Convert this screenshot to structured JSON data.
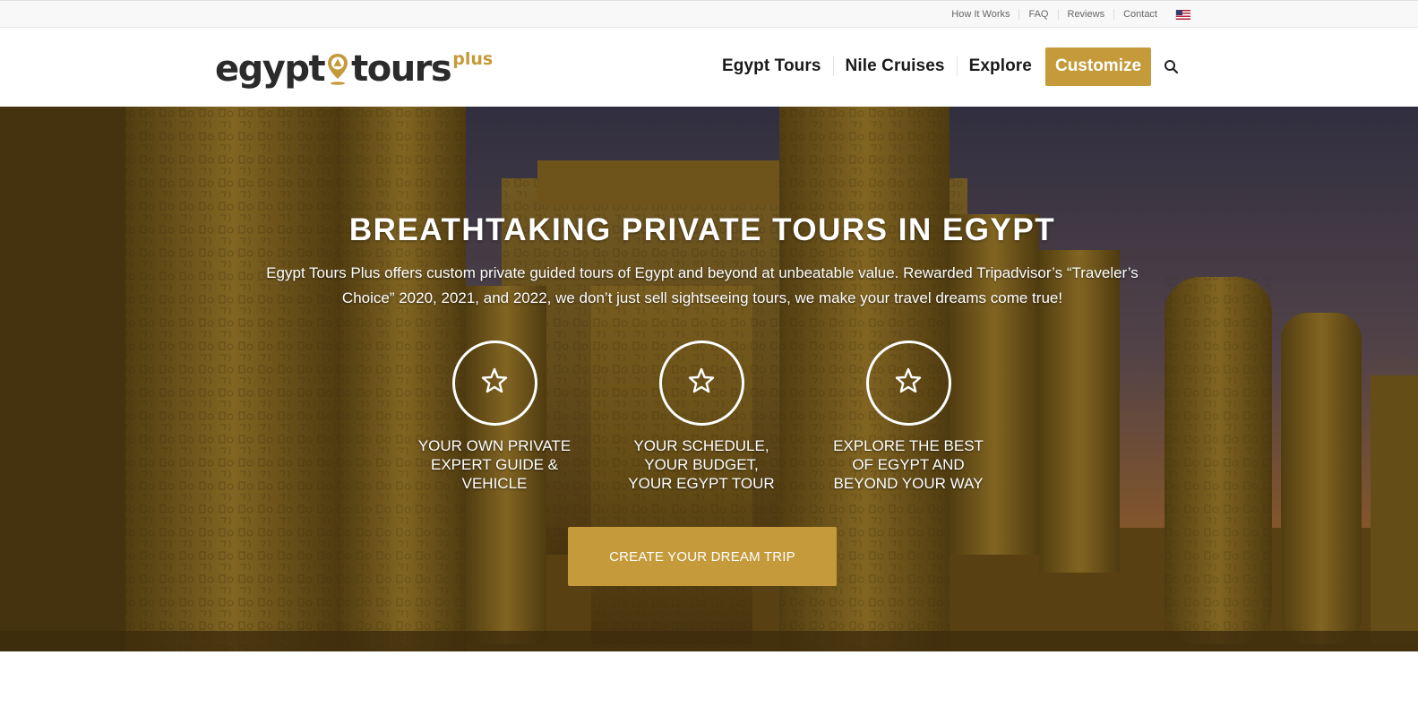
{
  "topbar": {
    "links": [
      "How It Works",
      "FAQ",
      "Reviews",
      "Contact"
    ],
    "flag_icon": "us-flag-icon"
  },
  "header": {
    "logo": {
      "word1": "egypt",
      "word2": "tours",
      "plus": "plus",
      "pin_icon": "location-pin-icon"
    },
    "nav": [
      "Egypt Tours",
      "Nile Cruises",
      "Explore"
    ],
    "cta": "Customize",
    "search_icon": "search-icon"
  },
  "hero": {
    "title": "BREATHTAKING PRIVATE TOURS IN EGYPT",
    "subtitle": "Egypt Tours Plus offers custom private guided tours of Egypt and beyond at unbeatable value. Rewarded Tripadvisor’s “Traveler’s Choice” 2020, 2021, and 2022, we don’t just sell sightseeing tours, we make your travel dreams come true!",
    "features": [
      {
        "icon": "star-icon",
        "lines": [
          "YOUR OWN PRIVATE",
          "EXPERT GUIDE &",
          "VEHICLE"
        ]
      },
      {
        "icon": "star-icon",
        "lines": [
          "YOUR SCHEDULE,",
          "YOUR BUDGET,",
          "YOUR EGYPT TOUR"
        ]
      },
      {
        "icon": "star-icon",
        "lines": [
          "EXPLORE THE BEST",
          "OF EGYPT AND",
          "BEYOND YOUR WAY"
        ]
      }
    ],
    "cta": "CREATE YOUR DREAM TRIP"
  },
  "colors": {
    "accent": "#c49a3a",
    "text_dark": "#1a1a1a",
    "topbar_bg": "#f8f8f8"
  }
}
